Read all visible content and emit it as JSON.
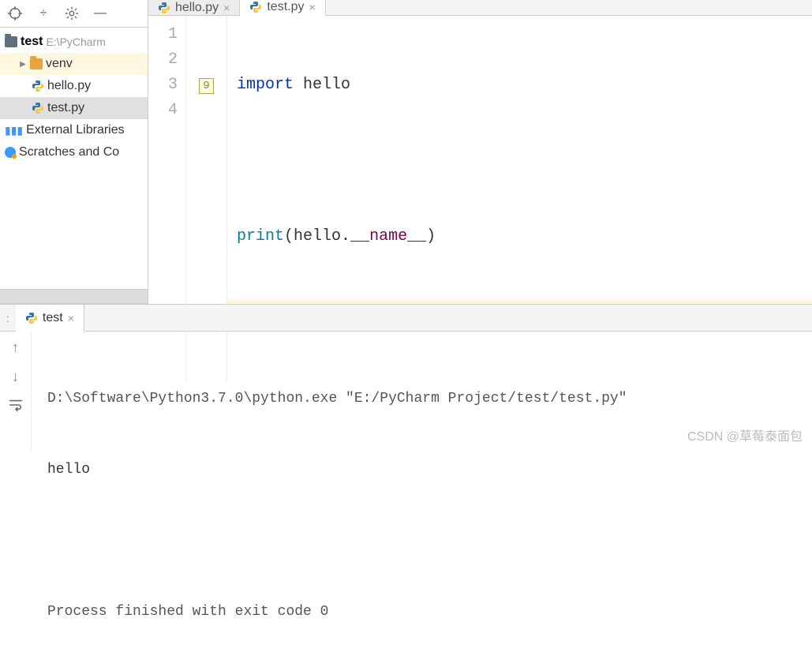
{
  "sidebar": {
    "project_name": "test",
    "project_path": "E:\\PyCharm ",
    "items": [
      {
        "label": "venv",
        "kind": "folder"
      },
      {
        "label": "hello.py",
        "kind": "file"
      },
      {
        "label": "test.py",
        "kind": "file"
      }
    ],
    "external_libraries_label": "External Libraries",
    "scratches_label": "Scratches and Co"
  },
  "tabs": [
    {
      "label": "hello.py",
      "active": false
    },
    {
      "label": "test.py",
      "active": true
    }
  ],
  "gutter": {
    "lines": [
      "1",
      "2",
      "3",
      "4"
    ],
    "badge_line": 3,
    "badge_value": "9"
  },
  "code": {
    "line1_import": "import",
    "line1_module": "hello",
    "line3_func": "print",
    "line3_open": "(",
    "line3_obj": "hello",
    "line3_dot": ".",
    "line3_attr": "__name__",
    "line3_close": ")"
  },
  "run": {
    "prefix_label": ":",
    "tab_label": "test",
    "output_cmd": "D:\\Software\\Python3.7.0\\python.exe \"E:/PyCharm Project/test/test.py\"",
    "output_line1": "hello",
    "output_exit": "Process finished with exit code 0"
  },
  "watermark": "CSDN @草莓泰面包"
}
